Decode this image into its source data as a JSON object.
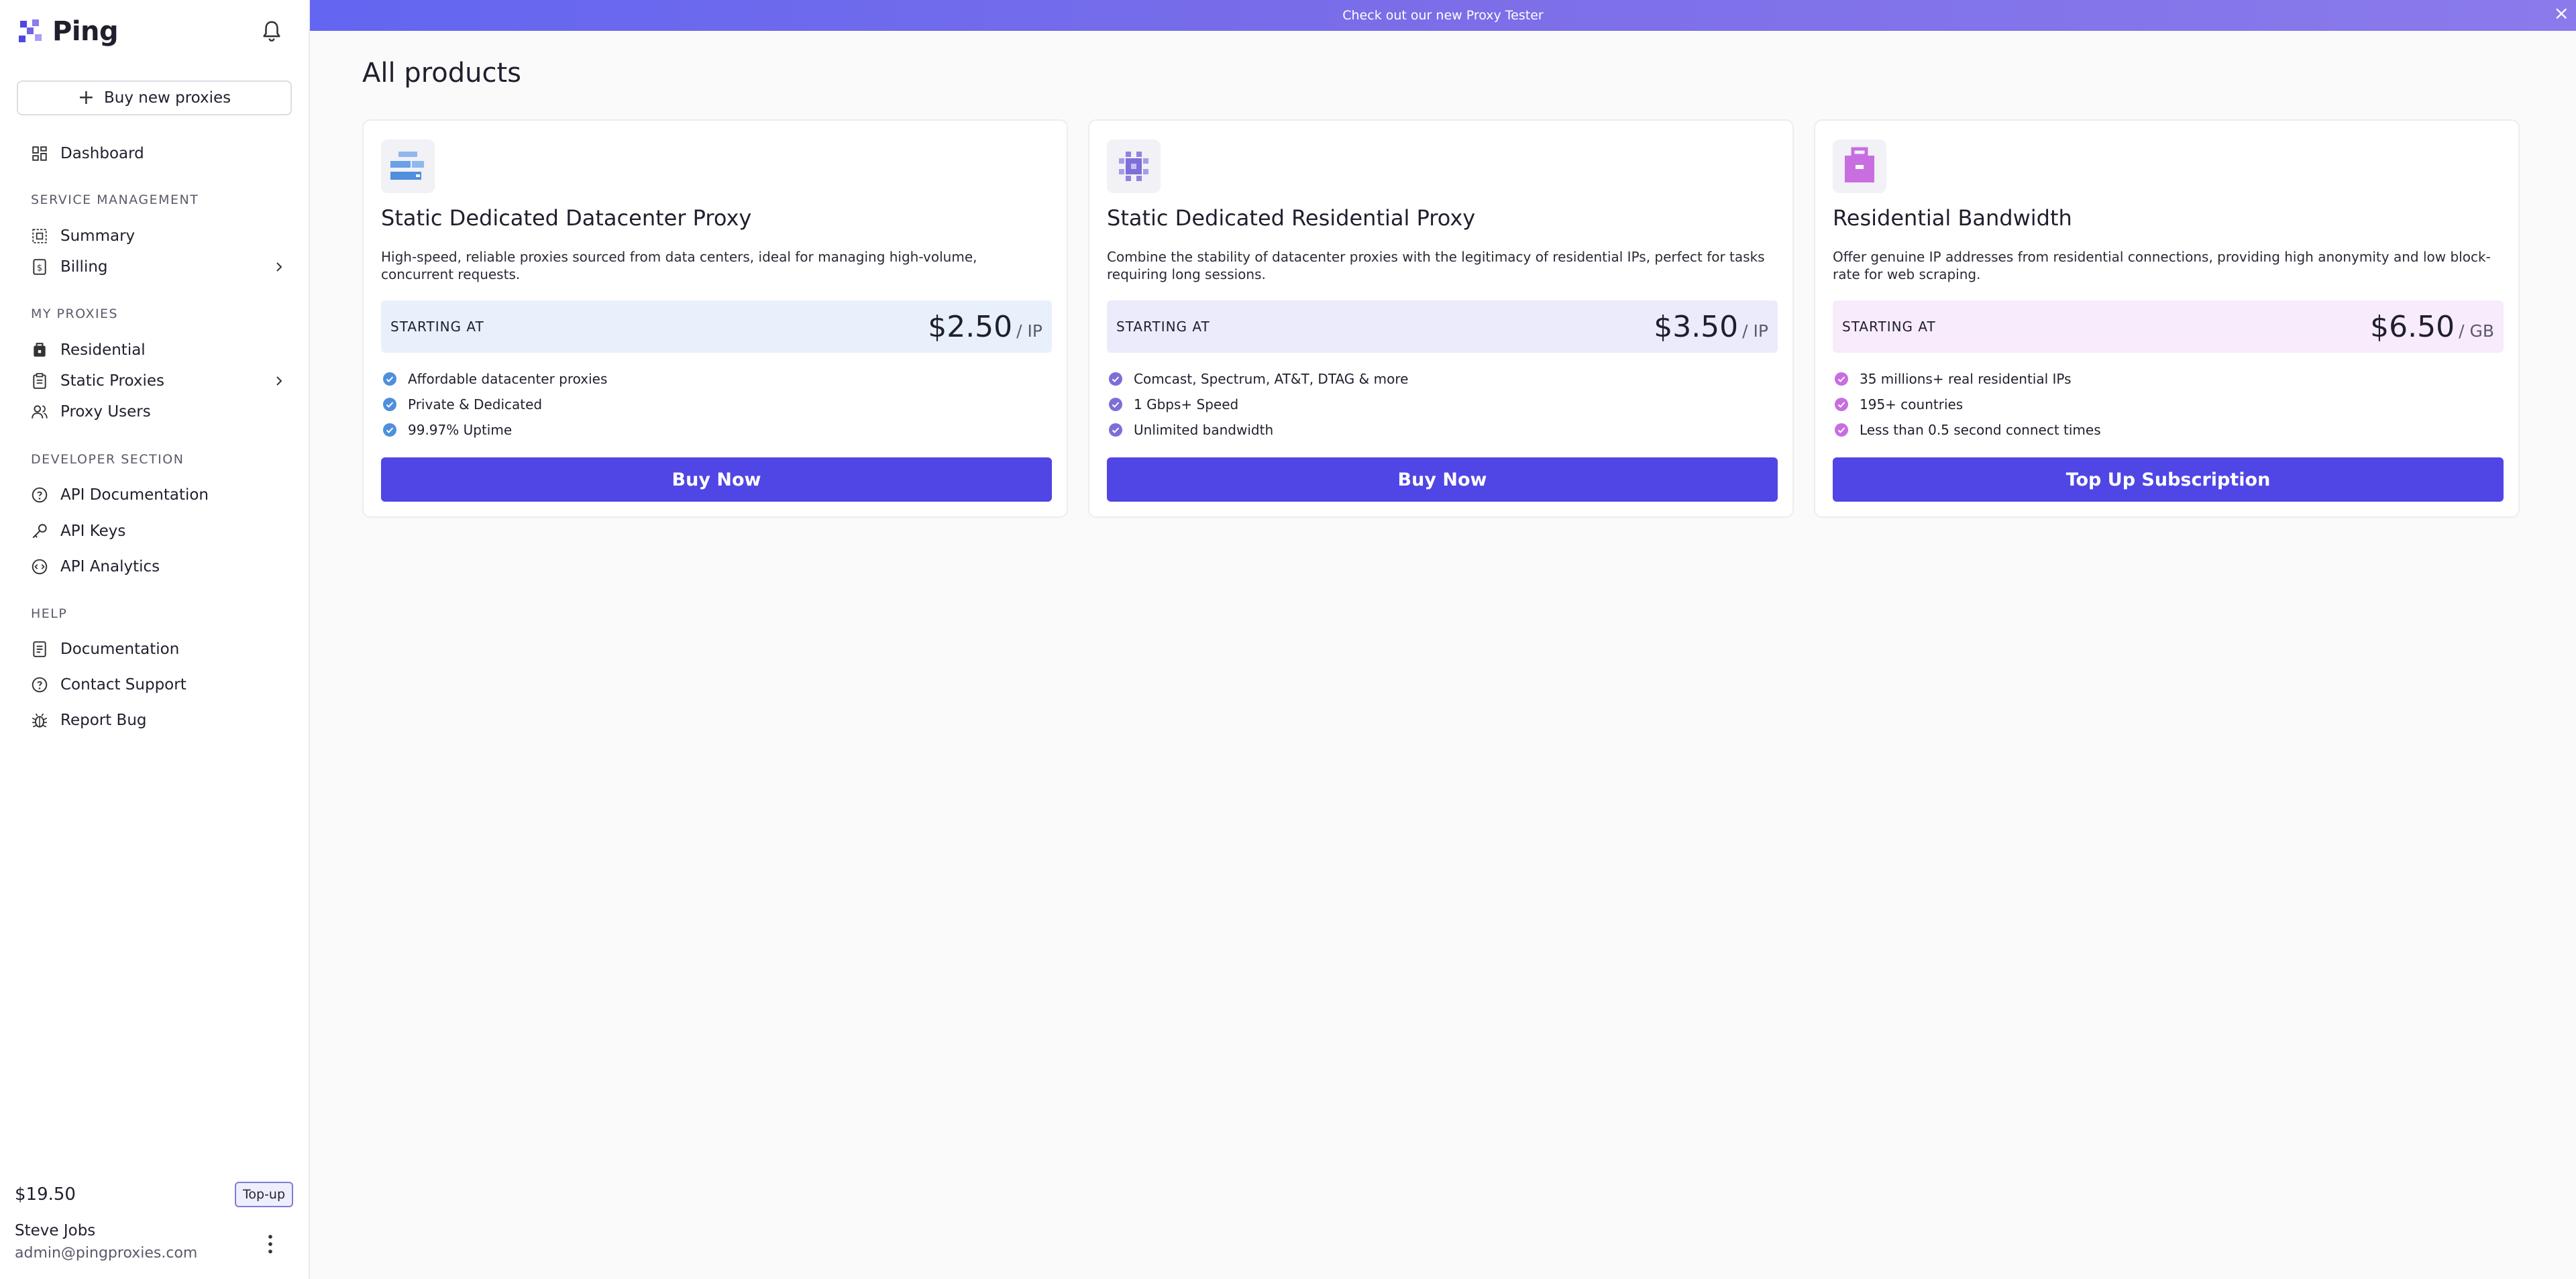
{
  "brand": {
    "name": "Ping"
  },
  "sidebar": {
    "buy_new_label": "Buy new proxies",
    "dashboard_label": "Dashboard",
    "sections": {
      "service": "SERVICE MANAGEMENT",
      "proxies": "MY PROXIES",
      "developer": "DEVELOPER SECTION",
      "help": "HELP"
    },
    "items": {
      "summary": "Summary",
      "billing": "Billing",
      "residential": "Residential",
      "static": "Static Proxies",
      "proxy_users": "Proxy Users",
      "api_docs": "API Documentation",
      "api_keys": "API Keys",
      "api_analytics": "API Analytics",
      "documentation": "Documentation",
      "contact": "Contact Support",
      "report_bug": "Report Bug"
    },
    "balance": "$19.50",
    "topup_label": "Top-up",
    "user": {
      "name": "Steve Jobs",
      "email": "admin@pingproxies.com"
    }
  },
  "banner": {
    "text": "Check out our new Proxy Tester"
  },
  "page": {
    "title": "All products"
  },
  "products": [
    {
      "title": "Static Dedicated Datacenter Proxy",
      "description": "High-speed, reliable proxies sourced from data centers, ideal for managing high-volume, concurrent requests.",
      "starting_label": "STARTING AT",
      "price": "$2.50",
      "unit": "/ IP",
      "features": [
        "Affordable datacenter proxies",
        "Private & Dedicated",
        "99.97% Uptime"
      ],
      "button": "Buy Now",
      "accent": "#4f8fdc",
      "box_bg": "#e8f0fc"
    },
    {
      "title": "Static Dedicated Residential Proxy",
      "description": "Combine the stability of datacenter proxies with the legitimacy of residential IPs, perfect for tasks requiring long sessions.",
      "starting_label": "STARTING AT",
      "price": "$3.50",
      "unit": "/ IP",
      "features": [
        "Comcast, Spectrum, AT&T, DTAG & more",
        "1 Gbps+ Speed",
        "Unlimited bandwidth"
      ],
      "button": "Buy Now",
      "accent": "#7c6fd8",
      "box_bg": "#ecebfb"
    },
    {
      "title": "Residential Bandwidth",
      "description": "Offer genuine IP addresses from residential connections, providing high anonymity and low block-rate for web scraping.",
      "starting_label": "STARTING AT",
      "price": "$6.50",
      "unit": "/ GB",
      "features": [
        "35 millions+ real residential IPs",
        "195+ countries",
        "Less than 0.5 second connect times"
      ],
      "button": "Top Up Subscription",
      "accent": "#c86ee0",
      "box_bg": "#f8ebfb"
    }
  ]
}
